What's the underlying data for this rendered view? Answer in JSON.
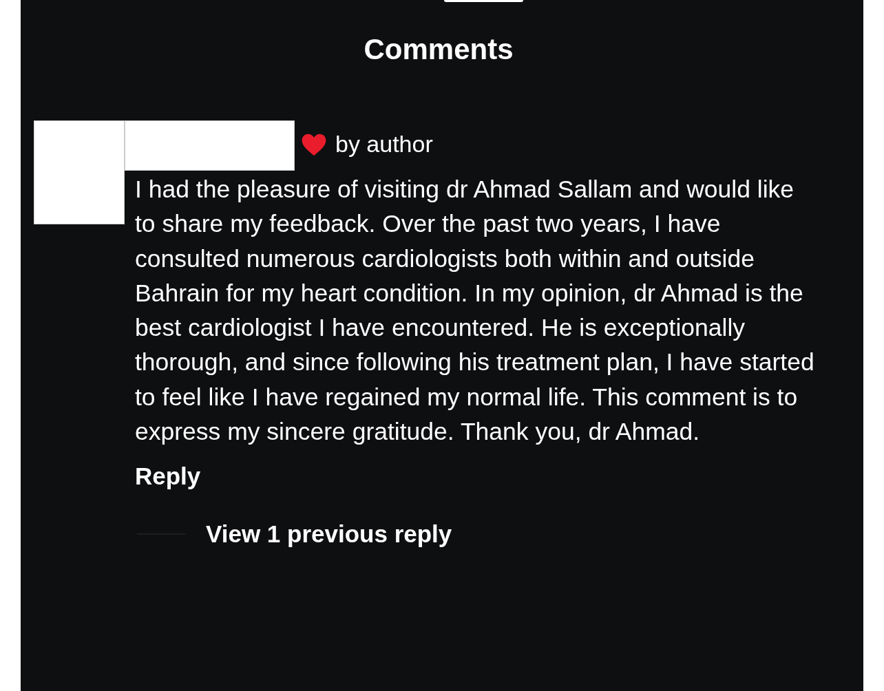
{
  "title": "Comments",
  "comment": {
    "badge": "by author",
    "text": "I had the pleasure of visiting dr Ahmad Sallam and would like to share my feedback. Over the past two years, I have consulted numerous cardiologists both within and outside Bahrain for my heart condition. In my opinion, dr Ahmad is the best cardiologist I have encountered. He is exceptionally thorough, and since following his treatment plan, I have started to feel like I have regained my normal life. This comment is to express my sincere gratitude. Thank you, dr Ahmad.",
    "reply_label": "Reply",
    "view_replies": "View 1 previous reply"
  }
}
